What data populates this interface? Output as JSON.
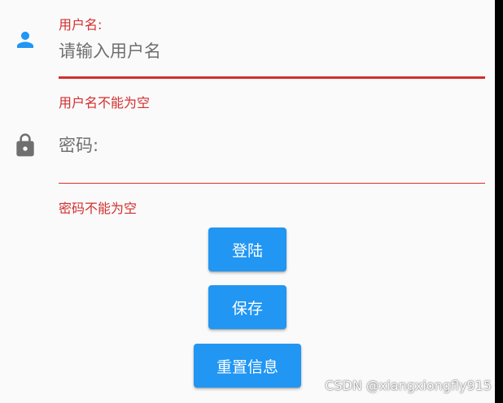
{
  "username": {
    "icon": "person-icon",
    "icon_color": "#2196f3",
    "label": "用户名:",
    "placeholder": "请输入用户名",
    "error": "用户名不能为空"
  },
  "password": {
    "icon": "lock-icon",
    "icon_color": "#6f6f6f",
    "placeholder": "密码:",
    "error": "密码不能为空"
  },
  "buttons": {
    "login": "登陆",
    "save": "保存",
    "reset": "重置信息"
  },
  "watermark": "CSDN @xiangxiongfly915",
  "colors": {
    "accent": "#2196f3",
    "error": "#d32f2f",
    "background": "#fafafa"
  }
}
